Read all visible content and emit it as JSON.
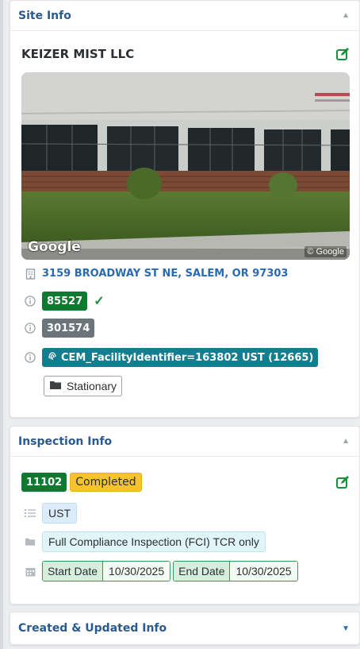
{
  "site_info": {
    "title": "Site Info",
    "facility_name": "KEIZER MIST LLC",
    "photo": {
      "logo": "Google",
      "copyright": "© Google"
    },
    "address": "3159 BROADWAY ST NE, SALEM, OR 97303",
    "id_primary": "85527",
    "id_secondary": "301574",
    "identifier_tag": "CEM_FacilityIdentifier=163802 UST (12665)",
    "category": "Stationary"
  },
  "inspection_info": {
    "title": "Inspection Info",
    "inspection_id": "11102",
    "status": "Completed",
    "program": "UST",
    "inspection_type": "Full Compliance Inspection (FCI) TCR only",
    "start_label": "Start Date",
    "start_value": "10/30/2025",
    "end_label": "End Date",
    "end_value": "10/30/2025"
  },
  "created_updated": {
    "title": "Created & Updated Info"
  },
  "colors": {
    "accent_blue": "#2a6bb0",
    "success_green": "#0d7a2f",
    "status_yellow": "#f5c42c",
    "tag_teal": "#127e8f"
  },
  "icons": {
    "collapse": "chevron-up-icon",
    "expand": "chevron-down-icon",
    "edit": "edit-square-icon",
    "building": "building-icon",
    "info": "info-circle-icon",
    "verified": "check-icon",
    "fingerprint": "fingerprint-icon",
    "folder": "folder-icon",
    "list": "list-icon",
    "calendar": "calendar-icon"
  }
}
